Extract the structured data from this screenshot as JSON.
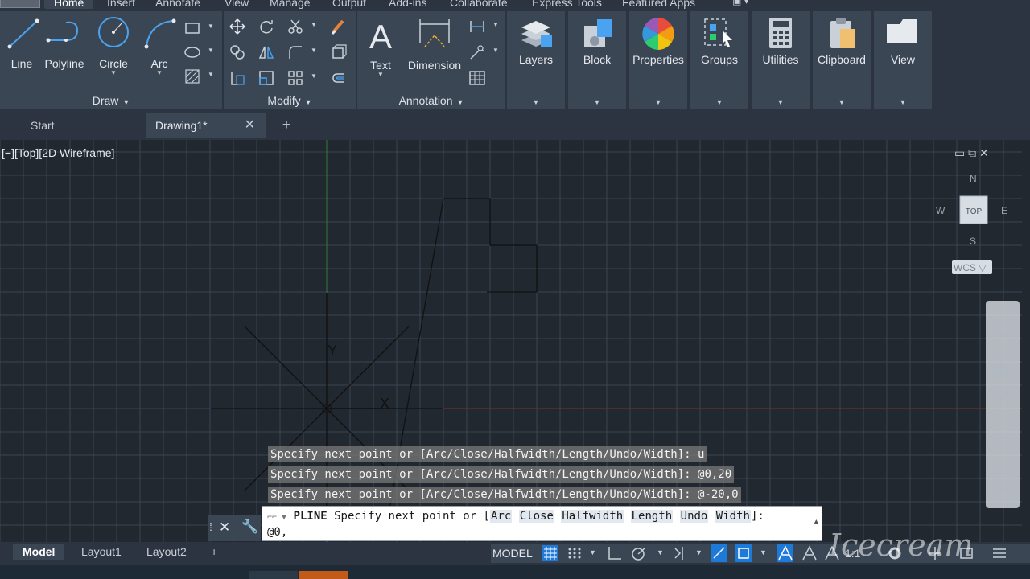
{
  "tabs": [
    "Home",
    "Insert",
    "Annotate",
    "View",
    "Manage",
    "Output",
    "Add-ins",
    "Collaborate",
    "Express Tools",
    "Featured Apps"
  ],
  "draw_panel": {
    "title": "Draw",
    "tools": [
      "Line",
      "Polyline",
      "Circle",
      "Arc"
    ]
  },
  "modify_panel": {
    "title": "Modify"
  },
  "annotation_panel": {
    "title": "Annotation",
    "tools": [
      "Text",
      "Dimension"
    ]
  },
  "big_panels": [
    "Layers",
    "Block",
    "Properties",
    "Groups",
    "Utilities",
    "Clipboard",
    "View"
  ],
  "file_tabs": {
    "start": "Start",
    "active": "Drawing1*",
    "close": "✕",
    "new": "+"
  },
  "viewport_label": "[−][Top][2D Wireframe]",
  "viewport_controls": "▭ ⧉ ✕",
  "viewcube": {
    "n": "N",
    "w": "W",
    "e": "E",
    "s": "S",
    "top": "TOP",
    "wcs": "WCS ▽"
  },
  "ucs": {
    "x": "X",
    "y": "Y"
  },
  "history": [
    "Specify next point or [Arc/Close/Halfwidth/Length/Undo/Width]: u",
    "Specify next point or [Arc/Close/Halfwidth/Length/Undo/Width]: @0,20",
    "Specify next point or [Arc/Close/Halfwidth/Length/Undo/Width]: @-20,0"
  ],
  "command": {
    "name": "PLINE",
    "prompt": "Specify next point or [",
    "options": [
      "Arc",
      "Close",
      "Halfwidth",
      "Length",
      "Undo",
      "Width"
    ],
    "suffix": "]:",
    "input": "@0,"
  },
  "layout_tabs": [
    "Model",
    "Layout1",
    "Layout2"
  ],
  "add_layout": "+",
  "status": {
    "model": "MODEL",
    "scale": "1:1"
  },
  "watermark": "Icecream",
  "colors": {
    "background": "#212830",
    "ribbon": "#3b4655",
    "grid": "#3c4552",
    "accent": "#1e7ad8"
  }
}
